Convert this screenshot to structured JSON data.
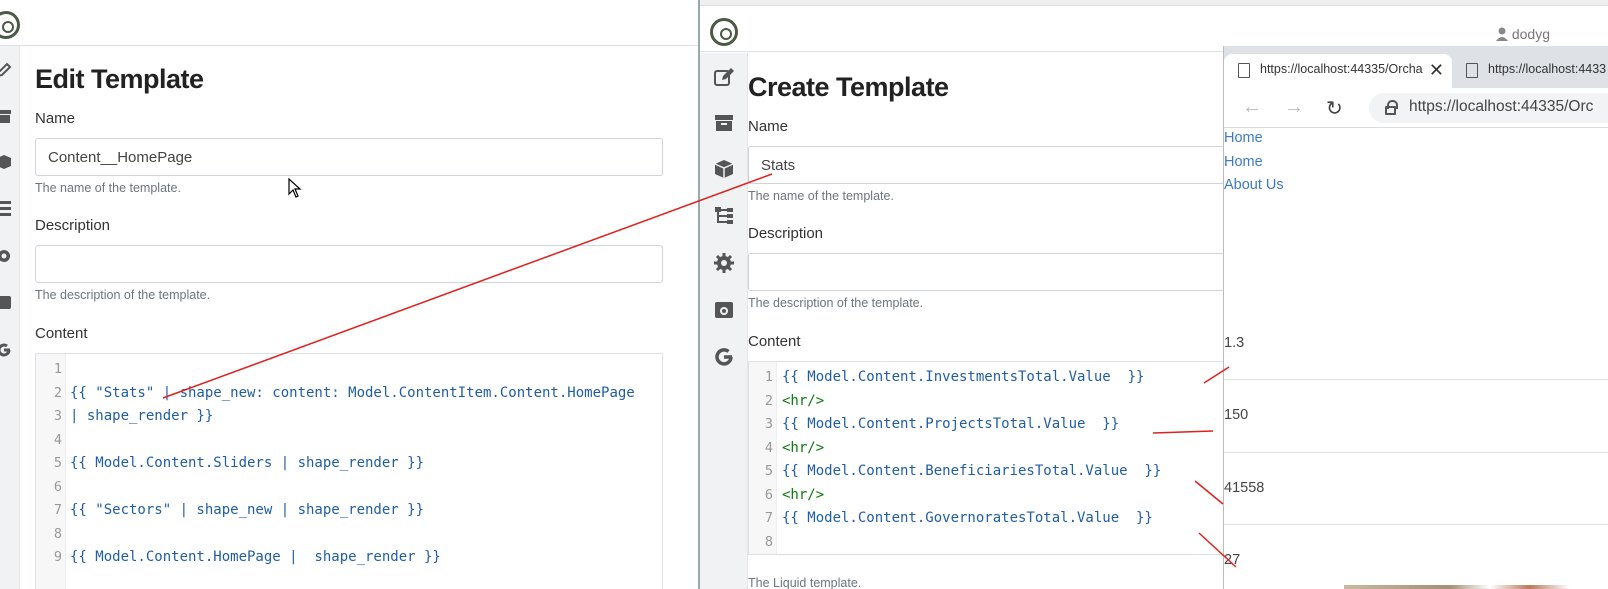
{
  "left": {
    "page_title": "Edit Template",
    "name_label": "Name",
    "name_value": "Content__HomePage",
    "name_help": "The name of the template.",
    "description_label": "Description",
    "description_value": "",
    "description_help": "The description of the template.",
    "content_label": "Content",
    "code_lines": [
      {
        "n": "1",
        "text": ""
      },
      {
        "n": "2",
        "text": "{{ \"Stats\" | shape_new: content: Model.ContentItem.Content.HomePage"
      },
      {
        "n": "3",
        "text": "| shape_render }}"
      },
      {
        "n": "4",
        "text": ""
      },
      {
        "n": "5",
        "text": "{{ Model.Content.Sliders | shape_render }}"
      },
      {
        "n": "6",
        "text": ""
      },
      {
        "n": "7",
        "text": "{{ \"Sectors\" | shape_new | shape_render }}"
      },
      {
        "n": "8",
        "text": ""
      },
      {
        "n": "9",
        "text": "{{ Model.Content.HomePage |  shape_render }}"
      }
    ]
  },
  "right": {
    "user": "dodyg",
    "page_title": "Create Template",
    "name_label": "Name",
    "name_value": "Stats",
    "name_help": "The name of the template.",
    "description_label": "Description",
    "description_value": "",
    "description_help": "The description of the template.",
    "content_label": "Content",
    "content_help": "The Liquid template.",
    "code_lines": [
      {
        "n": "1",
        "text": "{{ Model.Content.InvestmentsTotal.Value  }}"
      },
      {
        "n": "2",
        "text": "<hr/>"
      },
      {
        "n": "3",
        "text": "{{ Model.Content.ProjectsTotal.Value  }}"
      },
      {
        "n": "4",
        "text": "<hr/>"
      },
      {
        "n": "5",
        "text": "{{ Model.Content.BeneficiariesTotal.Value  }}"
      },
      {
        "n": "6",
        "text": "<hr/>"
      },
      {
        "n": "7",
        "text": "{{ Model.Content.GovernoratesTotal.Value  }}"
      },
      {
        "n": "8",
        "text": ""
      }
    ]
  },
  "browser": {
    "tab1_title": "https://localhost:44335/Orcha",
    "tab2_title": "https://localhost:4433",
    "address": "https://localhost:44335/Orc",
    "links": [
      "Home",
      "Home",
      "About Us"
    ],
    "stats": [
      "1.3",
      "150",
      "41558",
      "27"
    ]
  },
  "colors": {
    "annotation_arrow": "#e0201c",
    "link": "#3b79c9",
    "code": "#1f5da8",
    "code_tag": "#0a7b0a"
  }
}
